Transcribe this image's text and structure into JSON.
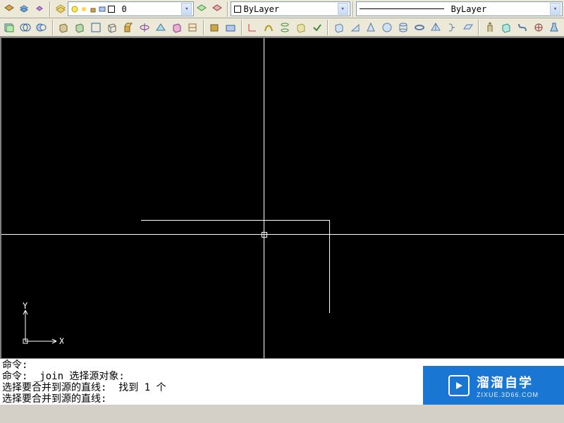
{
  "toolbars": {
    "layer_value": "0",
    "color_value": "ByLayer",
    "linetype_value": "ByLayer"
  },
  "ucs": {
    "x": "X",
    "y": "Y"
  },
  "command": {
    "line1": "命令:",
    "line2": "命令: _join 选择源对象:",
    "line3": "选择要合并到源的直线:  找到 1 个",
    "line4": "选择要合并到源的直线:"
  },
  "watermark": {
    "title": "溜溜自学",
    "sub": "ZIXUE.3D66.COM"
  }
}
